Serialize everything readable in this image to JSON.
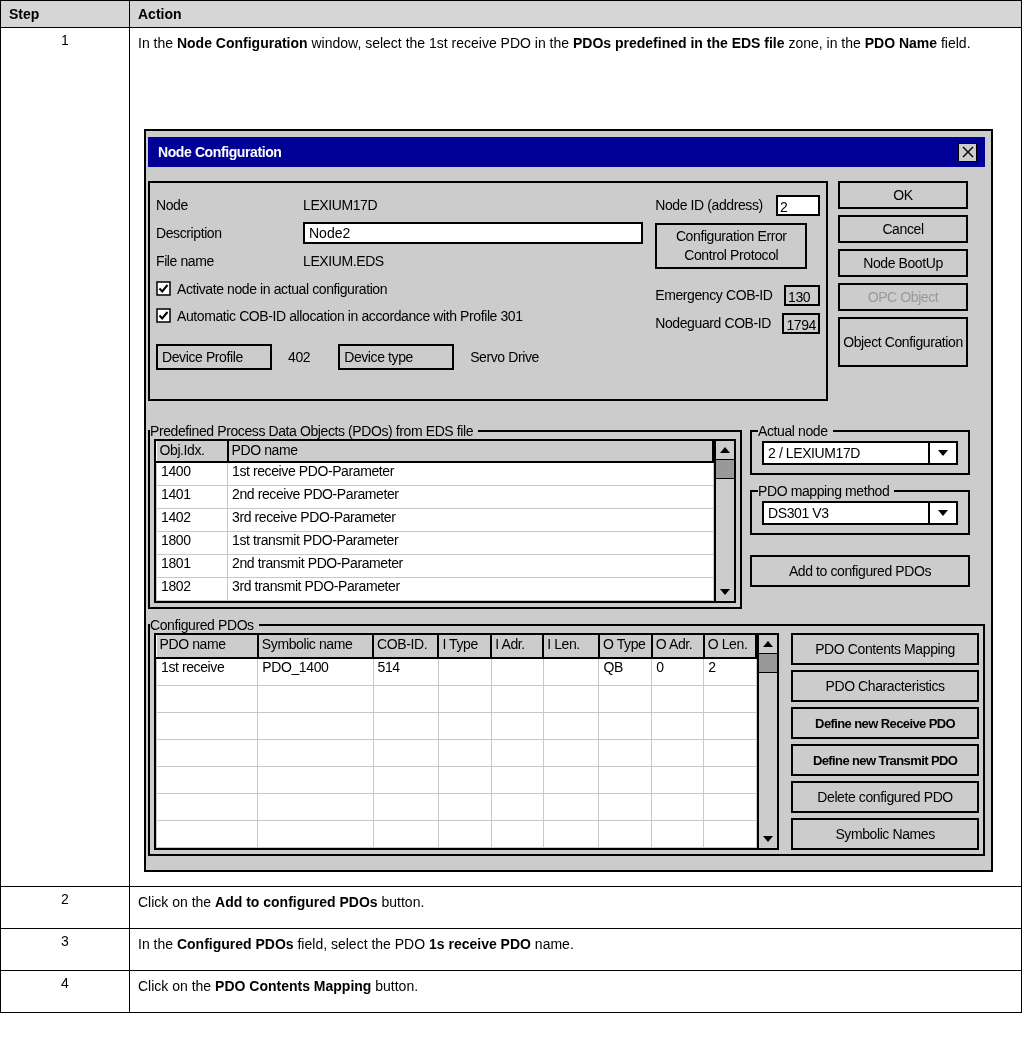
{
  "table": {
    "columns": [
      "Step",
      "Action"
    ],
    "steps": [
      {
        "number": "1",
        "text": "In the **Node Configuration** window, select the 1st receive PDO in the **PDOs predefined in the EDS file** zone, in the **PDO Name** field.",
        "dialog": {
          "title": "Node Configuration",
          "node": {
            "label": "Node",
            "value": "LEXIUM17D"
          },
          "description": {
            "label": "Description",
            "value": "Node2"
          },
          "file": {
            "label": "File name",
            "value": "LEXIUM.EDS"
          },
          "checkboxes": [
            {
              "label": "Activate node in actual configuration",
              "checked": true
            },
            {
              "label": "Automatic COB-ID allocation in accordance with Profile 301",
              "checked": true
            }
          ],
          "device_profile": {
            "label": "Device Profile",
            "value": "402"
          },
          "device_type": {
            "label": "Device type",
            "value": "Servo Drive"
          },
          "node_id": {
            "label": "Node ID (address)",
            "value": "2"
          },
          "error_control_button": "Configuration Error Control Protocol",
          "emergency": {
            "label": "Emergency COB-ID",
            "value": "130"
          },
          "nodeguard": {
            "label": "Nodeguard COB-ID",
            "value": "1794"
          },
          "side_buttons": [
            {
              "label": "OK",
              "disabled": false
            },
            {
              "label": "Cancel",
              "disabled": false
            },
            {
              "label": "Node BootUp",
              "disabled": false
            },
            {
              "label": "OPC Object",
              "disabled": true
            },
            {
              "label": "Object Configuration",
              "disabled": false
            }
          ],
          "predefined": {
            "title": "Predefined Process Data Objects (PDOs) from EDS file",
            "columns": [
              "Obj.Idx.",
              "PDO name"
            ],
            "rows": [
              [
                "1400",
                "1st receive PDO-Parameter"
              ],
              [
                "1401",
                "2nd receive PDO-Parameter"
              ],
              [
                "1402",
                "3rd receive PDO-Parameter"
              ],
              [
                "1800",
                "1st transmit PDO-Parameter"
              ],
              [
                "1801",
                "2nd transmit PDO-Parameter"
              ],
              [
                "1802",
                "3rd transmit PDO-Parameter"
              ]
            ]
          },
          "actual_node": {
            "title": "Actual node",
            "value": "2 / LEXIUM17D"
          },
          "mapping_method": {
            "title": "PDO mapping method",
            "value": "DS301 V3"
          },
          "add_button": "Add to configured PDOs",
          "configured": {
            "title": "Configured PDOs",
            "columns": [
              "PDO name",
              "Symbolic name",
              "COB-ID.",
              "I Type",
              "I Adr.",
              "I Len.",
              "O Type",
              "O Adr.",
              "O Len."
            ],
            "rows": [
              [
                "1st receive",
                "PDO_1400",
                "514",
                "",
                "",
                "",
                "QB",
                "0",
                "2"
              ]
            ]
          },
          "configured_buttons": [
            {
              "label": "PDO Contents Mapping",
              "bold": false
            },
            {
              "label": "PDO Characteristics",
              "bold": false
            },
            {
              "label": "Define new Receive PDO",
              "bold": true
            },
            {
              "label": "Define new Transmit PDO",
              "bold": true
            },
            {
              "label": "Delete configured PDO",
              "bold": false
            },
            {
              "label": "Symbolic Names",
              "bold": false
            }
          ]
        }
      },
      {
        "number": "2",
        "text": "Click on the **Add to configured PDOs** button."
      },
      {
        "number": "3",
        "text": "In the **Configured PDOs** field, select the PDO **1s receive PDO** name."
      },
      {
        "number": "4",
        "text": "Click on the **PDO Contents Mapping** button."
      }
    ]
  }
}
